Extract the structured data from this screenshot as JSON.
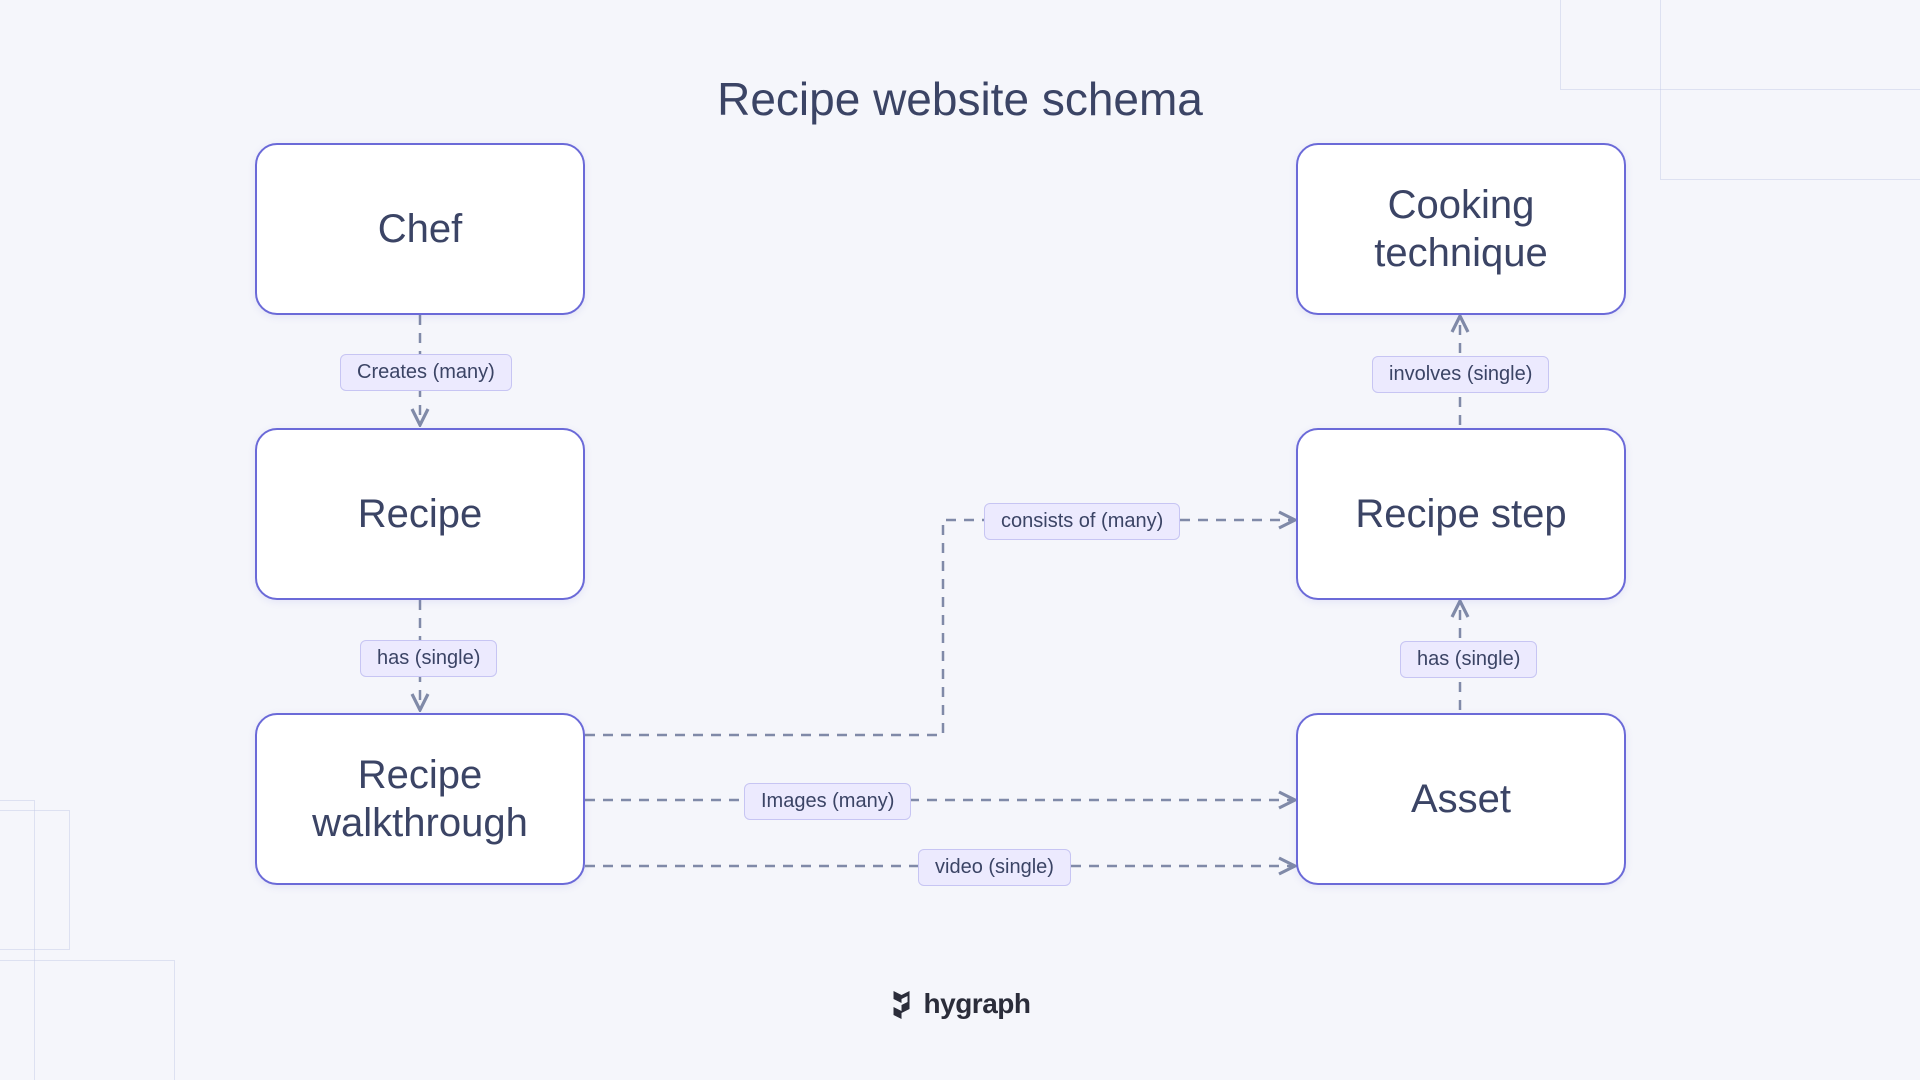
{
  "title": "Recipe website schema",
  "entities": {
    "chef": "Chef",
    "recipe": "Recipe",
    "recipe_walkthrough": "Recipe walkthrough",
    "cooking_technique": "Cooking technique",
    "recipe_step": "Recipe step",
    "asset": "Asset"
  },
  "relations": {
    "creates_many": "Creates (many)",
    "has_single_1": "has (single)",
    "consists_of_many": "consists of (many)",
    "images_many": "Images (many)",
    "video_single": "video (single)",
    "involves_single": "involves (single)",
    "has_single_2": "has (single)"
  },
  "brand": "hygraph"
}
